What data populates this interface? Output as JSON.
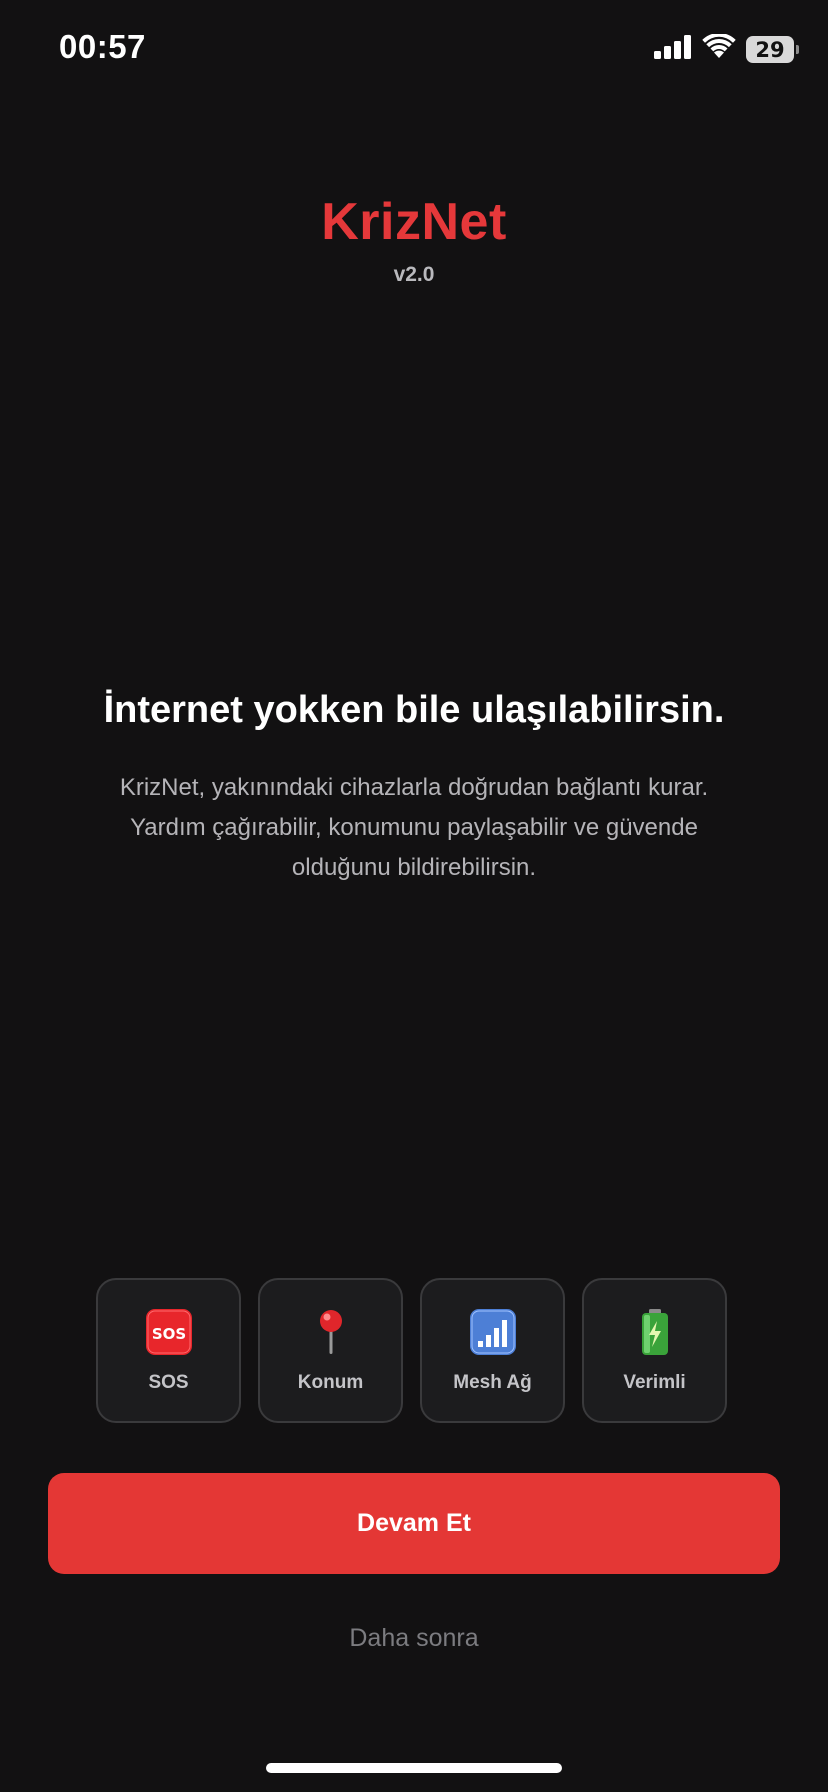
{
  "status_bar": {
    "time": "00:57",
    "battery": "29",
    "icons": [
      "signal-icon",
      "wifi-icon",
      "battery-icon"
    ]
  },
  "brand": {
    "title": "KrizNet",
    "version": "v2.0",
    "color": "#e5383a"
  },
  "hero": {
    "title": "İnternet yokken bile ulaşılabilirsin.",
    "description": "KrizNet, yakınındaki cihazlarla doğrudan bağlantı kurar. Yardım çağırabilir, konumunu paylaşabilir ve güvende olduğunu bildirebilirsin."
  },
  "features": [
    {
      "label": "SOS",
      "icon": "sos-icon"
    },
    {
      "label": "Konum",
      "icon": "location-pin-icon"
    },
    {
      "label": "Mesh Ağ",
      "icon": "signal-bars-icon"
    },
    {
      "label": "Verimli",
      "icon": "battery-charging-icon"
    }
  ],
  "actions": {
    "primary_label": "Devam Et",
    "secondary_label": "Daha sonra",
    "primary_color": "#e43735"
  }
}
